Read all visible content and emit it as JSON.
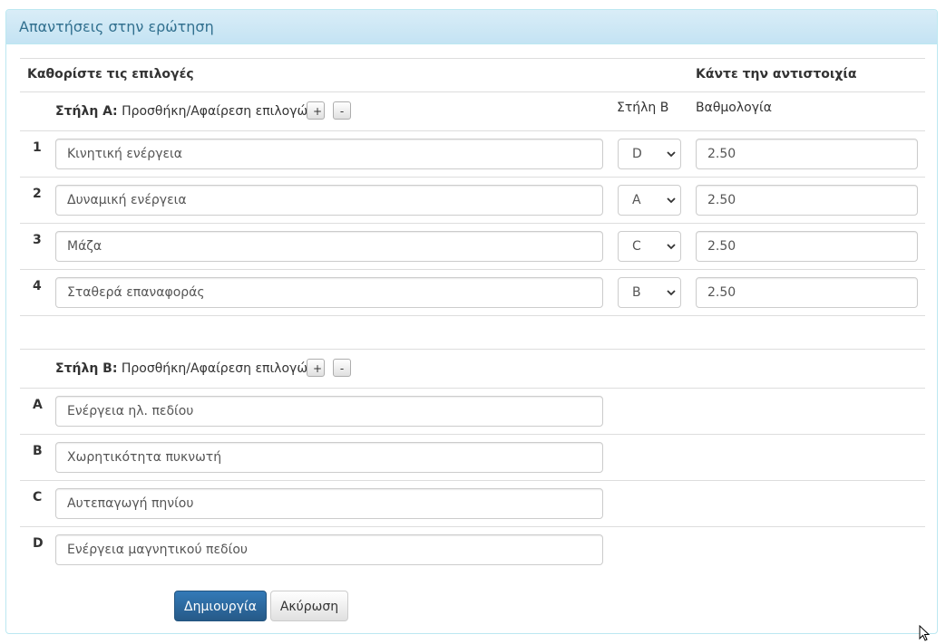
{
  "panel": {
    "title": "Απαντήσεις στην ερώτηση"
  },
  "header": {
    "define_options": "Καθορίστε τις επιλογές",
    "match_label": "Κάντε την αντιστοιχία",
    "column_b_label": "Στήλη Β",
    "score_label": "Βαθμολογία"
  },
  "column_a": {
    "title": "Στήλη Α:",
    "add_remove": "Προσθήκη/Αφαίρεση επιλογών:",
    "plus": "+",
    "minus": "-",
    "rows": [
      {
        "num": "1",
        "text": "Κινητική ενέργεια",
        "match": "D",
        "score": "2.50"
      },
      {
        "num": "2",
        "text": "Δυναμική ενέργεια",
        "match": "A",
        "score": "2.50"
      },
      {
        "num": "3",
        "text": "Μάζα",
        "match": "C",
        "score": "2.50"
      },
      {
        "num": "4",
        "text": "Σταθερά επαναφοράς",
        "match": "B",
        "score": "2.50"
      }
    ]
  },
  "column_b": {
    "title": "Στήλη Β:",
    "add_remove": "Προσθήκη/Αφαίρεση επιλογών:",
    "plus": "+",
    "minus": "-",
    "rows": [
      {
        "letter": "A",
        "text": "Ενέργεια ηλ. πεδίου"
      },
      {
        "letter": "B",
        "text": "Χωρητικότητα πυκνωτή"
      },
      {
        "letter": "C",
        "text": "Αυτεπαγωγή πηνίου"
      },
      {
        "letter": "D",
        "text": "Ενέργεια μαγνητικού πεδίου"
      }
    ]
  },
  "actions": {
    "create": "Δημιουργία",
    "cancel": "Ακύρωση"
  },
  "colors": {
    "primary": "#337ab7",
    "heading_text": "#31708f",
    "heading_bg": "#d9edf7"
  }
}
